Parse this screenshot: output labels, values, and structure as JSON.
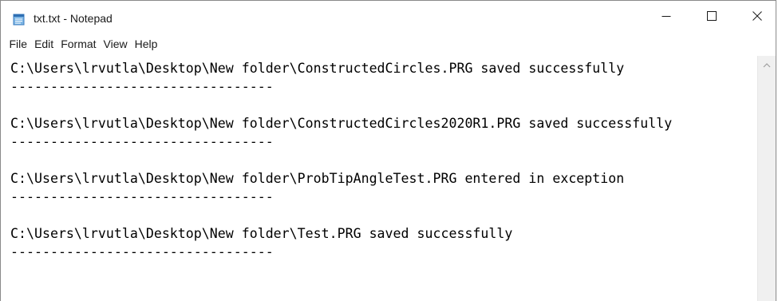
{
  "window": {
    "title": "txt.txt - Notepad",
    "icons": {
      "app": "notepad-icon",
      "minimize": "minimize-icon",
      "maximize": "maximize-icon",
      "close": "close-icon",
      "scroll_up": "chevron-up-icon"
    }
  },
  "menu": {
    "file": "File",
    "edit": "Edit",
    "format": "Format",
    "view": "View",
    "help": "Help"
  },
  "document": {
    "lines": [
      "C:\\Users\\lrvutla\\Desktop\\New folder\\ConstructedCircles.PRG saved successfully",
      "---------------------------------",
      "",
      "C:\\Users\\lrvutla\\Desktop\\New folder\\ConstructedCircles2020R1.PRG saved successfully",
      "---------------------------------",
      "",
      "C:\\Users\\lrvutla\\Desktop\\New folder\\ProbTipAngleTest.PRG entered in exception",
      "---------------------------------",
      "",
      "C:\\Users\\lrvutla\\Desktop\\New folder\\Test.PRG saved successfully",
      "---------------------------------"
    ]
  }
}
